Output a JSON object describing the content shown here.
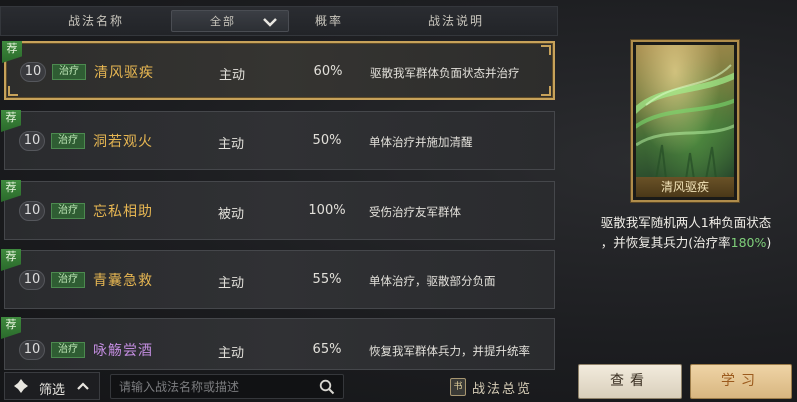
{
  "header": {
    "col_name": "战法名称",
    "filter_label": "全部",
    "col_prob": "概率",
    "col_desc": "战法说明"
  },
  "rec_label": "荐",
  "skills": [
    {
      "level": "10",
      "tag": "治疗",
      "name": "清风驱疾",
      "type": "主动",
      "prob": "60%",
      "desc": "驱散我军群体负面状态并治疗",
      "recommended": true
    },
    {
      "level": "10",
      "tag": "治疗",
      "name": "洞若观火",
      "type": "主动",
      "prob": "50%",
      "desc": "单体治疗并施加清醒",
      "recommended": true
    },
    {
      "level": "10",
      "tag": "治疗",
      "name": "忘私相助",
      "type": "被动",
      "prob": "100%",
      "desc": "受伤治疗友军群体",
      "recommended": true
    },
    {
      "level": "10",
      "tag": "治疗",
      "name": "青囊急救",
      "type": "主动",
      "prob": "55%",
      "desc": "单体治疗，驱散部分负面",
      "recommended": true
    },
    {
      "level": "10",
      "tag": "治疗",
      "name": "咏觞尝酒",
      "type": "主动",
      "prob": "65%",
      "desc": "恢复我军群体兵力，并提升统率",
      "recommended": true
    }
  ],
  "bottom": {
    "filter_label": "筛选",
    "search_placeholder": "请输入战法名称或描述",
    "overview_label": "战法总览",
    "overview_icon": "书"
  },
  "detail": {
    "card_title": "清风驱疾",
    "line1": "驱散我军随机两人1种负面状态",
    "line2_prefix": "，并恢复其兵力(治疗率",
    "line2_value": "180%",
    "line2_suffix": ")"
  },
  "buttons": {
    "view": "查看",
    "learn": "学习"
  },
  "colors": {
    "selected_border": "#c7a25a",
    "tag_green": "#2f5d33",
    "gold_name": "#e6b652",
    "purple_name": "#c38de0",
    "heal_rate": "#7fd07a"
  }
}
